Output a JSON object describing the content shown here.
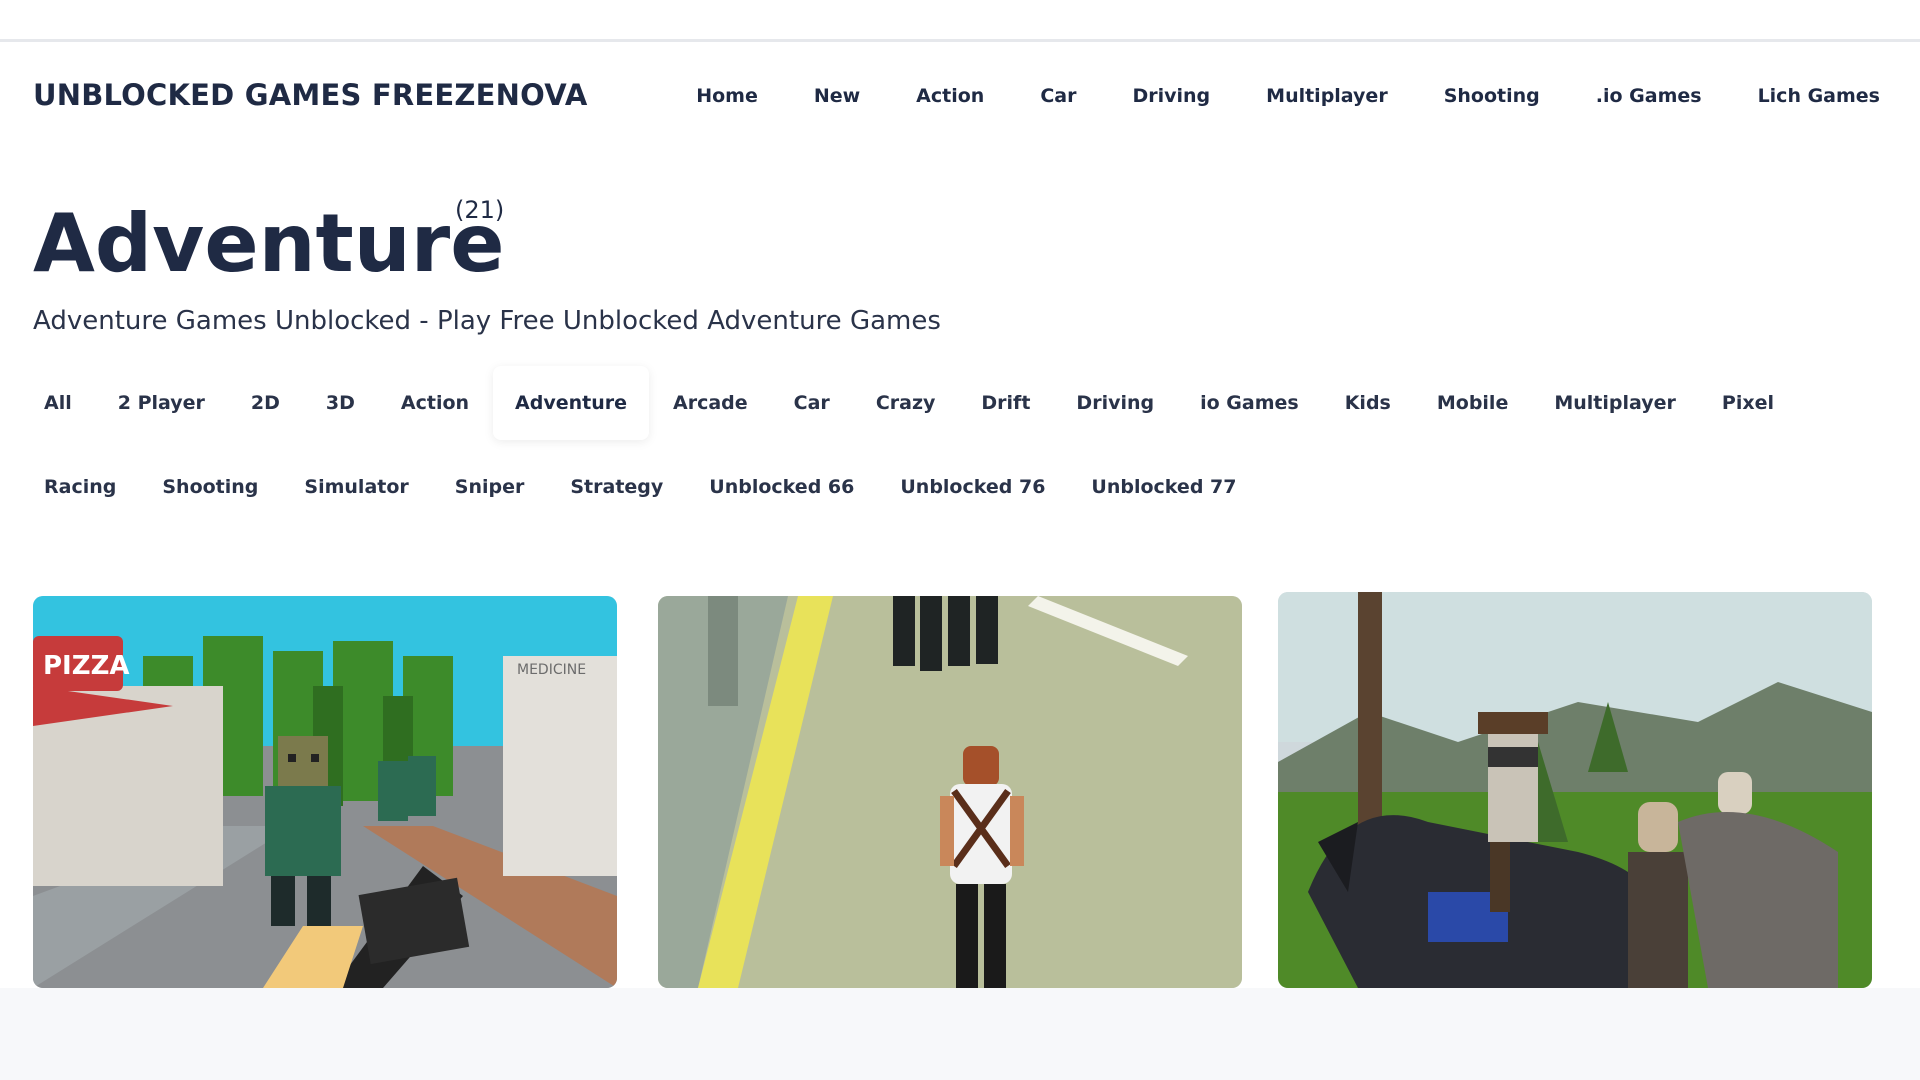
{
  "site": {
    "title": "UNBLOCKED GAMES FREEZENOVA"
  },
  "nav": [
    {
      "label": "Home"
    },
    {
      "label": "New"
    },
    {
      "label": "Action"
    },
    {
      "label": "Car"
    },
    {
      "label": "Driving"
    },
    {
      "label": "Multiplayer"
    },
    {
      "label": "Shooting"
    },
    {
      "label": ".io Games"
    },
    {
      "label": "Lich Games"
    }
  ],
  "page": {
    "title": "Adventure",
    "count": "(21)",
    "subtitle": "Adventure Games Unblocked - Play Free Unblocked Adventure Games"
  },
  "tags": [
    {
      "label": "All"
    },
    {
      "label": "2 Player"
    },
    {
      "label": "2D"
    },
    {
      "label": "3D"
    },
    {
      "label": "Action"
    },
    {
      "label": "Adventure",
      "active": true
    },
    {
      "label": "Arcade"
    },
    {
      "label": "Car"
    },
    {
      "label": "Crazy"
    },
    {
      "label": "Drift"
    },
    {
      "label": "Driving"
    },
    {
      "label": "io Games"
    },
    {
      "label": "Kids"
    },
    {
      "label": "Mobile"
    },
    {
      "label": "Multiplayer"
    },
    {
      "label": "Pixel"
    },
    {
      "label": "Racing"
    },
    {
      "label": "Shooting"
    },
    {
      "label": "Simulator"
    },
    {
      "label": "Sniper"
    },
    {
      "label": "Strategy"
    },
    {
      "label": "Unblocked 66"
    },
    {
      "label": "Unblocked 76"
    },
    {
      "label": "Unblocked 77"
    }
  ],
  "cards": {
    "card1": {
      "sign_pizza": "PIZZA",
      "sign_medicine": "MEDICINE"
    }
  },
  "colors": {
    "text": "#1f2a44",
    "active_tag_bg": "#ffffff"
  }
}
